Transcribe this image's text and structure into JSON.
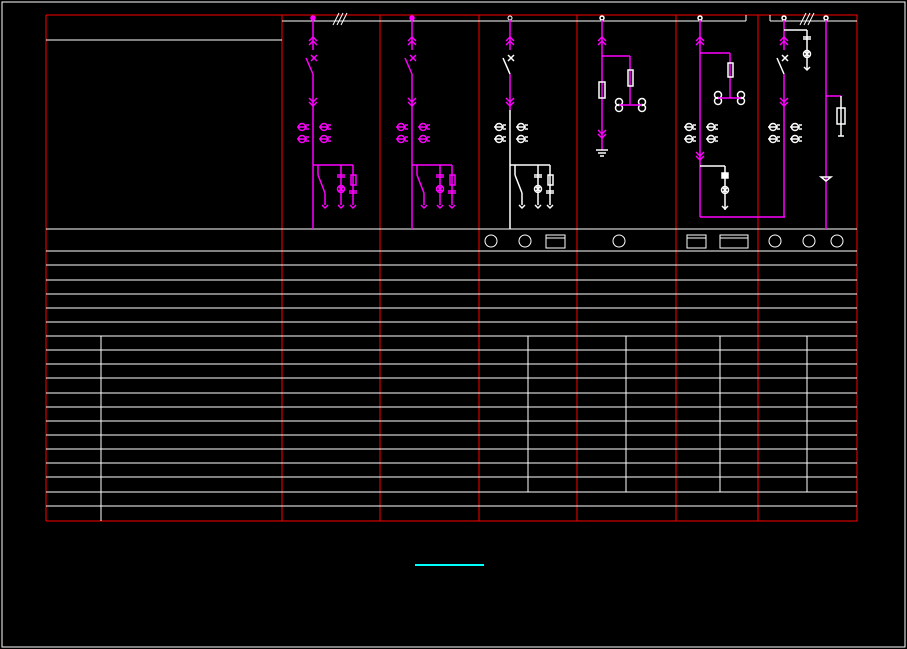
{
  "drawing": {
    "title_block_text": "",
    "footer_title_text": ""
  },
  "colors": {
    "background": "#000000",
    "frame": "#ffffff",
    "grid_vertical": "#ff0000",
    "grid_horizontal": "#ffffff",
    "circuit": "#ff00ff",
    "annotation": "#ffffff",
    "title_underline": "#00ffff"
  },
  "panels": [
    {
      "id": "panel-1",
      "type": "incoming-feeder-with-voltage-transformer"
    },
    {
      "id": "panel-2",
      "type": "incoming-feeder-with-voltage-transformer"
    },
    {
      "id": "panel-3",
      "type": "outgoing-feeder-with-voltage-transformer"
    },
    {
      "id": "panel-4",
      "type": "voltage-transformer-with-earth"
    },
    {
      "id": "panel-5",
      "type": "bus-coupler-with-cable-compartment"
    },
    {
      "id": "panel-6",
      "type": "outgoing-feeder-with-arrester"
    }
  ],
  "icons": [
    "busbar-tick-icon",
    "disconnector-icon",
    "circuit-breaker-icon",
    "current-transformer-icon",
    "fuse-icon",
    "capacitor-icon",
    "earth-icon",
    "indicator-lamp-icon",
    "meter-box-icon",
    "arrester-icon"
  ]
}
